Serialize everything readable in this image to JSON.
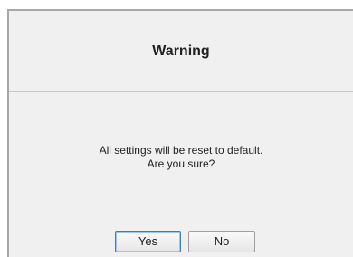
{
  "dialog": {
    "title": "Warning",
    "message_line1": "All settings will be reset to default.",
    "message_line2": "Are you sure?",
    "buttons": {
      "yes_label": "Yes",
      "no_label": "No"
    },
    "focused_button": "Yes"
  },
  "colors": {
    "background": "#f0f0f0",
    "frame_line": "#a8a8a8",
    "focus_border": "#3c7fb1"
  }
}
